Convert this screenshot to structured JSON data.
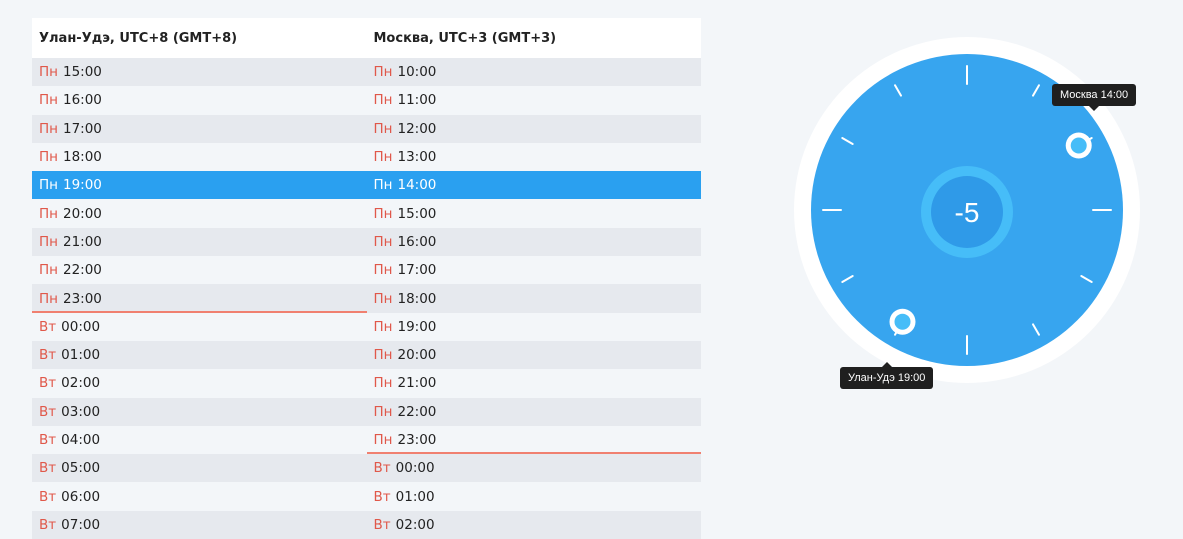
{
  "table": {
    "headers": [
      "Улан-Удэ, UTC+8 (GMT+8)",
      "Москва, UTC+3 (GMT+3)"
    ],
    "selected_row": 4,
    "rows": [
      [
        {
          "day": "Пн",
          "time": "15:00"
        },
        {
          "day": "Пн",
          "time": "10:00"
        }
      ],
      [
        {
          "day": "Пн",
          "time": "16:00"
        },
        {
          "day": "Пн",
          "time": "11:00"
        }
      ],
      [
        {
          "day": "Пн",
          "time": "17:00"
        },
        {
          "day": "Пн",
          "time": "12:00"
        }
      ],
      [
        {
          "day": "Пн",
          "time": "18:00"
        },
        {
          "day": "Пн",
          "time": "13:00"
        }
      ],
      [
        {
          "day": "Пн",
          "time": "19:00"
        },
        {
          "day": "Пн",
          "time": "14:00"
        }
      ],
      [
        {
          "day": "Пн",
          "time": "20:00"
        },
        {
          "day": "Пн",
          "time": "15:00"
        }
      ],
      [
        {
          "day": "Пн",
          "time": "21:00"
        },
        {
          "day": "Пн",
          "time": "16:00"
        }
      ],
      [
        {
          "day": "Пн",
          "time": "22:00"
        },
        {
          "day": "Пн",
          "time": "17:00"
        }
      ],
      [
        {
          "day": "Пн",
          "time": "23:00",
          "divider": true
        },
        {
          "day": "Пн",
          "time": "18:00"
        }
      ],
      [
        {
          "day": "Вт",
          "time": "00:00"
        },
        {
          "day": "Пн",
          "time": "19:00"
        }
      ],
      [
        {
          "day": "Вт",
          "time": "01:00"
        },
        {
          "day": "Пн",
          "time": "20:00"
        }
      ],
      [
        {
          "day": "Вт",
          "time": "02:00"
        },
        {
          "day": "Пн",
          "time": "21:00"
        }
      ],
      [
        {
          "day": "Вт",
          "time": "03:00"
        },
        {
          "day": "Пн",
          "time": "22:00"
        }
      ],
      [
        {
          "day": "Вт",
          "time": "04:00"
        },
        {
          "day": "Пн",
          "time": "23:00",
          "divider": true
        }
      ],
      [
        {
          "day": "Вт",
          "time": "05:00"
        },
        {
          "day": "Вт",
          "time": "00:00"
        }
      ],
      [
        {
          "day": "Вт",
          "time": "06:00"
        },
        {
          "day": "Вт",
          "time": "01:00"
        }
      ],
      [
        {
          "day": "Вт",
          "time": "07:00"
        },
        {
          "day": "Вт",
          "time": "02:00"
        }
      ]
    ]
  },
  "dial": {
    "difference": "-5",
    "tooltip_moscow": "Москва 14:00",
    "tooltip_ulan_ude": "Улан-Удэ 19:00",
    "moscow_hour": 14,
    "ulan_ude_hour": 19,
    "colors": {
      "face": "#37a5ef",
      "ring": "#ffffff",
      "center_ring": "#46bdf8",
      "center_fill": "#2f9ae8",
      "handle": "#46bdf8",
      "divider": "#f08070",
      "day": "#e0584a",
      "selected": "#2aa0f0"
    }
  }
}
